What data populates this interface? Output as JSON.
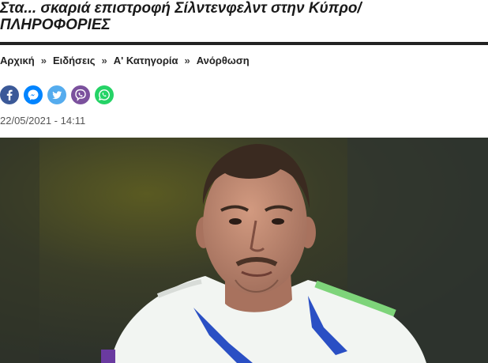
{
  "article": {
    "title_line1": "Στα... σκαριά επιστροφή Σίλντενφελντ στην Κύπρο/",
    "title_line2": "ΠΛΗΡΟΦΟΡΙΕΣ",
    "date": "22/05/2021 - 14:11"
  },
  "breadcrumb": {
    "items": [
      "Αρχική",
      "Ειδήσεις",
      "Α' Κατηγορία",
      "Ανόρθωση"
    ],
    "separator": "»"
  },
  "share": {
    "icons": [
      {
        "name": "facebook-icon",
        "color": "#3b5998"
      },
      {
        "name": "messenger-icon",
        "color": "#0084ff"
      },
      {
        "name": "twitter-icon",
        "color": "#55acee"
      },
      {
        "name": "viber-icon",
        "color": "#7b519d"
      },
      {
        "name": "whatsapp-icon",
        "color": "#25d366"
      }
    ]
  },
  "photo": {
    "description": "footballer-portrait",
    "colors": {
      "background": "#3a3d28",
      "skin": "#b88570",
      "kit": "#f2f5f2",
      "hair": "#3a2a20"
    }
  }
}
